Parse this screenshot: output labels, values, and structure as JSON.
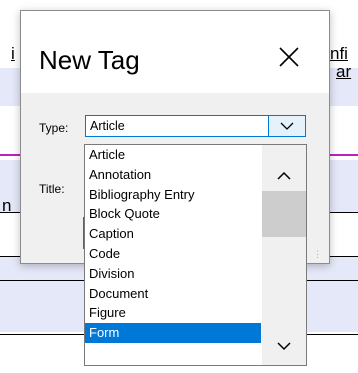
{
  "background": {
    "snip_top_left": "i",
    "snip_top_right": "nfi",
    "snip_second_right": "ar",
    "snip_mid_left": "n"
  },
  "dialog": {
    "title": "New Tag",
    "type_label": "Type:",
    "type_value": "Article",
    "title_label": "Title:"
  },
  "dropdown": {
    "items": [
      "Article",
      "Annotation",
      "Bibliography Entry",
      "Block Quote",
      "Caption",
      "Code",
      "Division",
      "Document",
      "Figure",
      "Form"
    ],
    "selected": "Form"
  },
  "icons": {
    "close": "close-icon",
    "dropdown": "chevron-down-icon",
    "scroll_up": "chevron-up-icon",
    "scroll_down": "chevron-down-icon"
  },
  "colors": {
    "accent": "#0078d7",
    "highlight_band": "#e4e8f8",
    "magenta_rule": "#c020c0"
  }
}
